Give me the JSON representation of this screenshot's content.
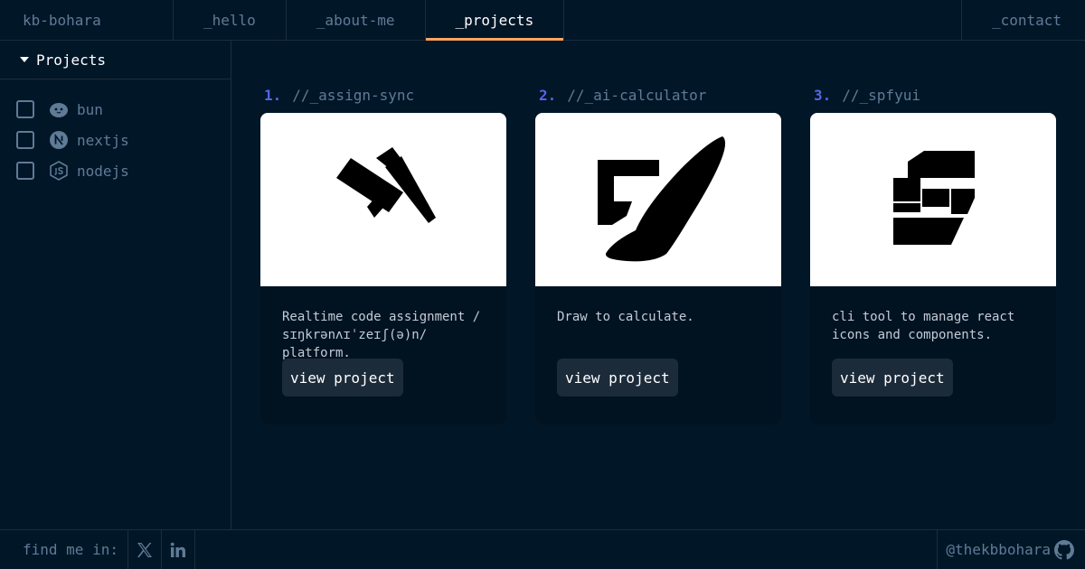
{
  "header": {
    "brand": "kb-bohara",
    "tabs": [
      {
        "label": "_hello",
        "active": false
      },
      {
        "label": "_about-me",
        "active": false
      },
      {
        "label": "_projects",
        "active": true
      }
    ],
    "contact": "_contact"
  },
  "sidebar": {
    "title": "Projects",
    "filters": [
      {
        "label": "bun",
        "icon": "bun-icon",
        "checked": false
      },
      {
        "label": "nextjs",
        "icon": "nextjs-icon",
        "checked": false
      },
      {
        "label": "nodejs",
        "icon": "nodejs-icon",
        "checked": false
      }
    ]
  },
  "projects": [
    {
      "num": "1.",
      "name": "//_assign-sync",
      "icon": "hammer-icon",
      "description": "Realtime code assignment / sɪŋkrənʌɪˈzeɪʃ(ə)n/ platform.",
      "button": "view project"
    },
    {
      "num": "2.",
      "name": "//_ai-calculator",
      "icon": "brush-icon",
      "description": "Draw to calculate.",
      "button": "view project"
    },
    {
      "num": "3.",
      "name": "//_spfyui",
      "icon": "spfyui-logo-icon",
      "description": "cli tool to manage react icons and components.",
      "button": "view project"
    }
  ],
  "footer": {
    "find_me": "find me in:",
    "socials": [
      "x-icon",
      "linkedin-icon"
    ],
    "github_handle": "@thekbbohara"
  },
  "colors": {
    "background": "#011627",
    "border": "#1e2d3d",
    "text": "#607b96",
    "accent_underline": "#fea55f",
    "project_number": "#5565e8",
    "card_body": "#011221",
    "button": "#1c2b3a"
  }
}
